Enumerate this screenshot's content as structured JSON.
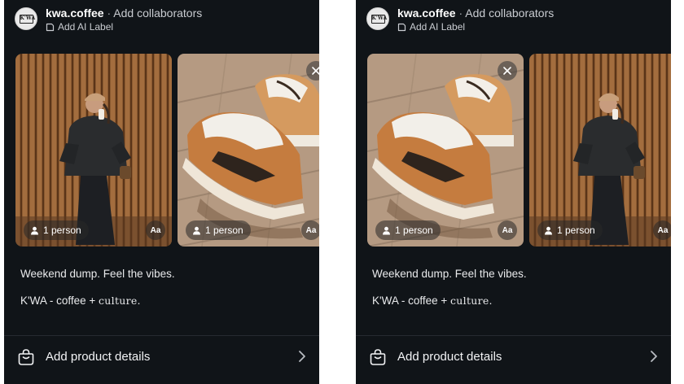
{
  "panels": [
    {
      "header": {
        "username": "kwa.coffee",
        "separator": "·",
        "collab_label": "Add collaborators",
        "ai_label": "Add AI Label",
        "avatar_text": "K'WA"
      },
      "photos": [
        {
          "subject": "person",
          "tag": "1 person",
          "aa": "Aa"
        },
        {
          "subject": "shoes",
          "tag": "1 person",
          "aa": "Aa"
        }
      ],
      "caption": {
        "line1": "Weekend dump. Feel the vibes.",
        "line2_prefix": "K'WA - coffee + ",
        "line2_styled": "culture",
        "line2_suffix": "."
      },
      "product": {
        "label": "Add product details"
      }
    },
    {
      "header": {
        "username": "kwa.coffee",
        "separator": "·",
        "collab_label": "Add collaborators",
        "ai_label": "Add AI Label",
        "avatar_text": "K'WA"
      },
      "photos": [
        {
          "subject": "shoes",
          "tag": "1 person",
          "aa": "Aa"
        },
        {
          "subject": "person",
          "tag": "1 person",
          "aa": "Aa"
        }
      ],
      "caption": {
        "line1": "Weekend dump. Feel the vibes.",
        "line2_prefix": "K'WA - coffee + ",
        "line2_styled": "culture",
        "line2_suffix": "."
      },
      "product": {
        "label": "Add product details"
      }
    }
  ],
  "colors": {
    "background": "#101418",
    "text": "#f2f3f5",
    "muted_text": "#c9ccd1"
  }
}
